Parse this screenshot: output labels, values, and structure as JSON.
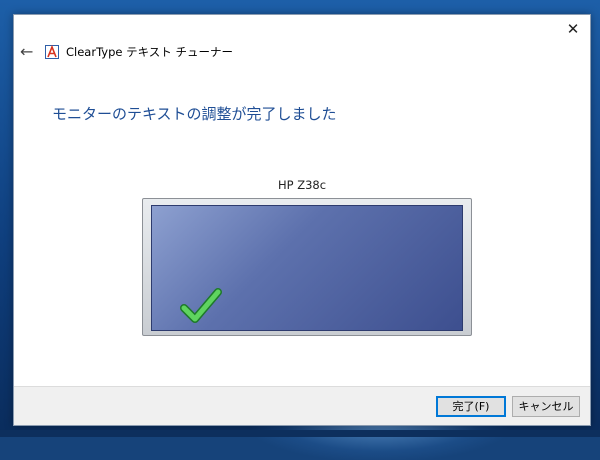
{
  "window": {
    "title": "ClearType テキスト チューナー",
    "close_symbol": "✕",
    "back_symbol": "←"
  },
  "main": {
    "heading": "モニターのテキストの調整が完了しました",
    "monitor_name": "HP Z38c"
  },
  "buttons": {
    "finish_label": "完了(F)",
    "cancel_label": "キャンセル"
  },
  "icons": {
    "app": "cleartype-app-icon",
    "back": "back-arrow-icon",
    "close": "close-icon",
    "check": "checkmark-icon"
  },
  "colors": {
    "heading": "#1f4e95",
    "monitor_screen": "#5d71ad",
    "check": "#3cb54a",
    "default_button_border": "#0078d7"
  }
}
